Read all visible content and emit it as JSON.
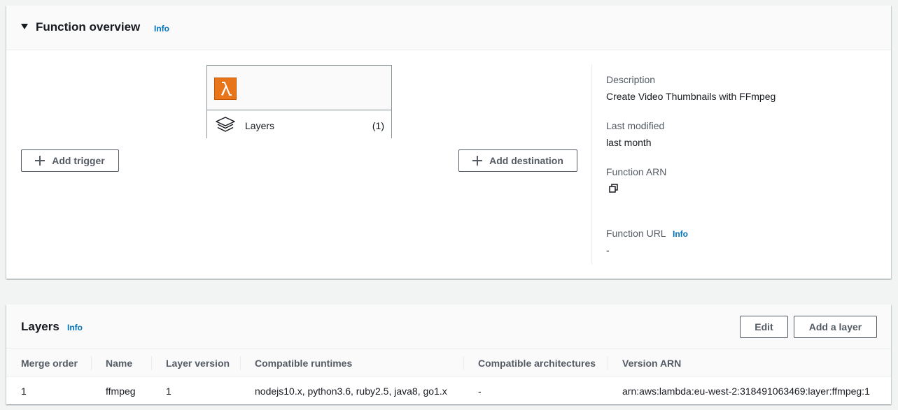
{
  "overview": {
    "title": "Function overview",
    "info": "Info",
    "function_box": {
      "layers_label": "Layers",
      "layers_count": "(1)"
    },
    "add_trigger": "Add trigger",
    "add_destination": "Add destination",
    "details": {
      "description_label": "Description",
      "description_value": "Create Video Thumbnails with FFmpeg",
      "last_modified_label": "Last modified",
      "last_modified_value": "last month",
      "function_arn_label": "Function ARN",
      "function_url_label": "Function URL",
      "function_url_info": "Info",
      "function_url_value": "-"
    }
  },
  "layers": {
    "title": "Layers",
    "info": "Info",
    "edit_button": "Edit",
    "add_layer_button": "Add a layer",
    "columns": [
      "Merge order",
      "Name",
      "Layer version",
      "Compatible runtimes",
      "Compatible architectures",
      "Version ARN"
    ],
    "rows": [
      [
        "1",
        "ffmpeg",
        "1",
        "nodejs10.x, python3.6, ruby2.5, java8, go1.x",
        "-",
        "arn:aws:lambda:eu-west-2:318491063469:layer:ffmpeg:1"
      ]
    ]
  },
  "colors": {
    "accent_link": "#0073bb",
    "lambda_orange": "#e8751a"
  },
  "icons": [
    "caret-down-icon",
    "lambda-icon",
    "layers-icon",
    "plus-icon",
    "copy-icon"
  ]
}
